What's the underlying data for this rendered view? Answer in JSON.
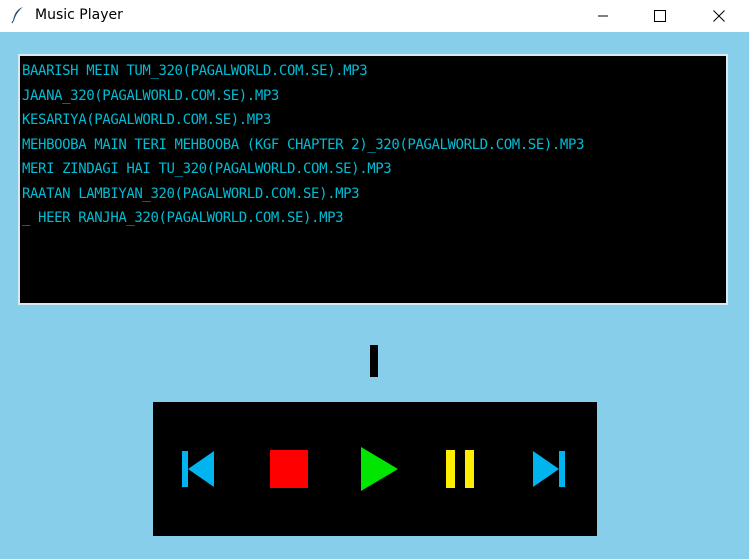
{
  "window": {
    "title": "Music Player"
  },
  "playlist": {
    "tracks": [
      "BAARISH MEIN TUM_320(PAGALWORLD.COM.SE).MP3",
      "JAANA_320(PAGALWORLD.COM.SE).MP3",
      "KESARIYA(PAGALWORLD.COM.SE).MP3",
      "MEHBOOBA MAIN TERI MEHBOOBA (KGF CHAPTER 2)_320(PAGALWORLD.COM.SE).MP3",
      "MERI ZINDAGI HAI TU_320(PAGALWORLD.COM.SE).MP3",
      "RAATAN LAMBIYAN_320(PAGALWORLD.COM.SE).MP3",
      "_ HEER RANJHA_320(PAGALWORLD.COM.SE).MP3"
    ]
  },
  "controls": {
    "icons": [
      "skip-previous-icon",
      "stop-icon",
      "play-icon",
      "pause-icon",
      "skip-next-icon"
    ]
  },
  "colors": {
    "background": "#87ceeb",
    "track_text": "#00bcd4",
    "prev_next": "#00b4f0",
    "stop": "#ff0000",
    "play": "#00e600",
    "pause": "#ffee00"
  }
}
